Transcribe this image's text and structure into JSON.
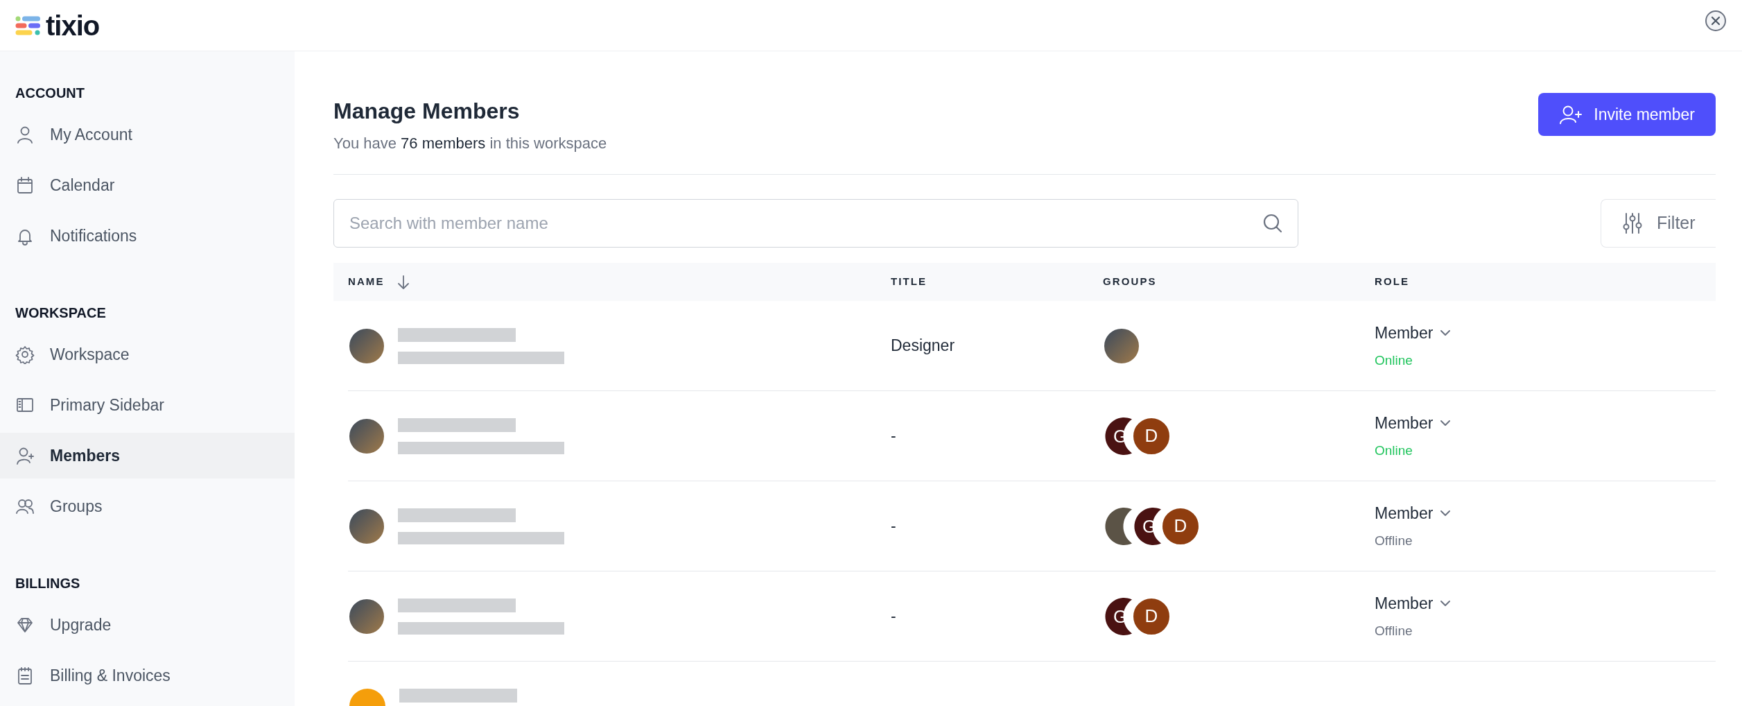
{
  "logo": {
    "text": "tixio"
  },
  "sidebar": {
    "sections": [
      {
        "heading": "ACCOUNT",
        "items": [
          {
            "label": "My Account",
            "selected": false
          },
          {
            "label": "Calendar",
            "selected": false
          },
          {
            "label": "Notifications",
            "selected": false
          }
        ]
      },
      {
        "heading": "WORKSPACE",
        "items": [
          {
            "label": "Workspace",
            "selected": false
          },
          {
            "label": "Primary Sidebar",
            "selected": false
          },
          {
            "label": "Members",
            "selected": true
          },
          {
            "label": "Groups",
            "selected": false
          }
        ]
      },
      {
        "heading": "BILLINGS",
        "items": [
          {
            "label": "Upgrade",
            "selected": false
          },
          {
            "label": "Billing & Invoices",
            "selected": false
          }
        ]
      }
    ]
  },
  "header": {
    "title": "Manage Members",
    "subtitle": "You have  **76 members** in this workspace",
    "invite_button": "Invite member"
  },
  "search": {
    "placeholder": "Search with member name"
  },
  "filter_button": "Filter",
  "table": {
    "columns": [
      "NAME",
      "TITLE",
      "GROUPS",
      "ROLE"
    ],
    "rows": [
      {
        "avatar": {
          "kind": "photo"
        },
        "title": "Designer",
        "groups": [
          {
            "kind": "photo"
          }
        ],
        "role": "Member",
        "status": {
          "label": "Online",
          "online": true
        }
      },
      {
        "avatar": {
          "kind": "photo"
        },
        "title": "-",
        "groups": [
          {
            "kind": "initial",
            "label": "G",
            "color": "#4a1212"
          },
          {
            "kind": "initial",
            "label": "D",
            "color": "#8f3d0f"
          }
        ],
        "role": "Member",
        "status": {
          "label": "Online",
          "online": true
        }
      },
      {
        "avatar": {
          "kind": "photo"
        },
        "title": "-",
        "groups": [
          {
            "kind": "photo"
          },
          {
            "kind": "initial",
            "label": "G",
            "color": "#4a1212"
          },
          {
            "kind": "initial",
            "label": "D",
            "color": "#8f3d0f"
          }
        ],
        "role": "Member",
        "status": {
          "label": "Offline",
          "online": false
        }
      },
      {
        "avatar": {
          "kind": "photo"
        },
        "title": "-",
        "groups": [
          {
            "kind": "initial",
            "label": "G",
            "color": "#4a1212"
          },
          {
            "kind": "initial",
            "label": "D",
            "color": "#8f3d0f"
          }
        ],
        "role": "Member",
        "status": {
          "label": "Offline",
          "online": false
        }
      },
      {
        "avatar": {
          "kind": "initial",
          "color": "#f59e0b"
        }
      }
    ]
  }
}
